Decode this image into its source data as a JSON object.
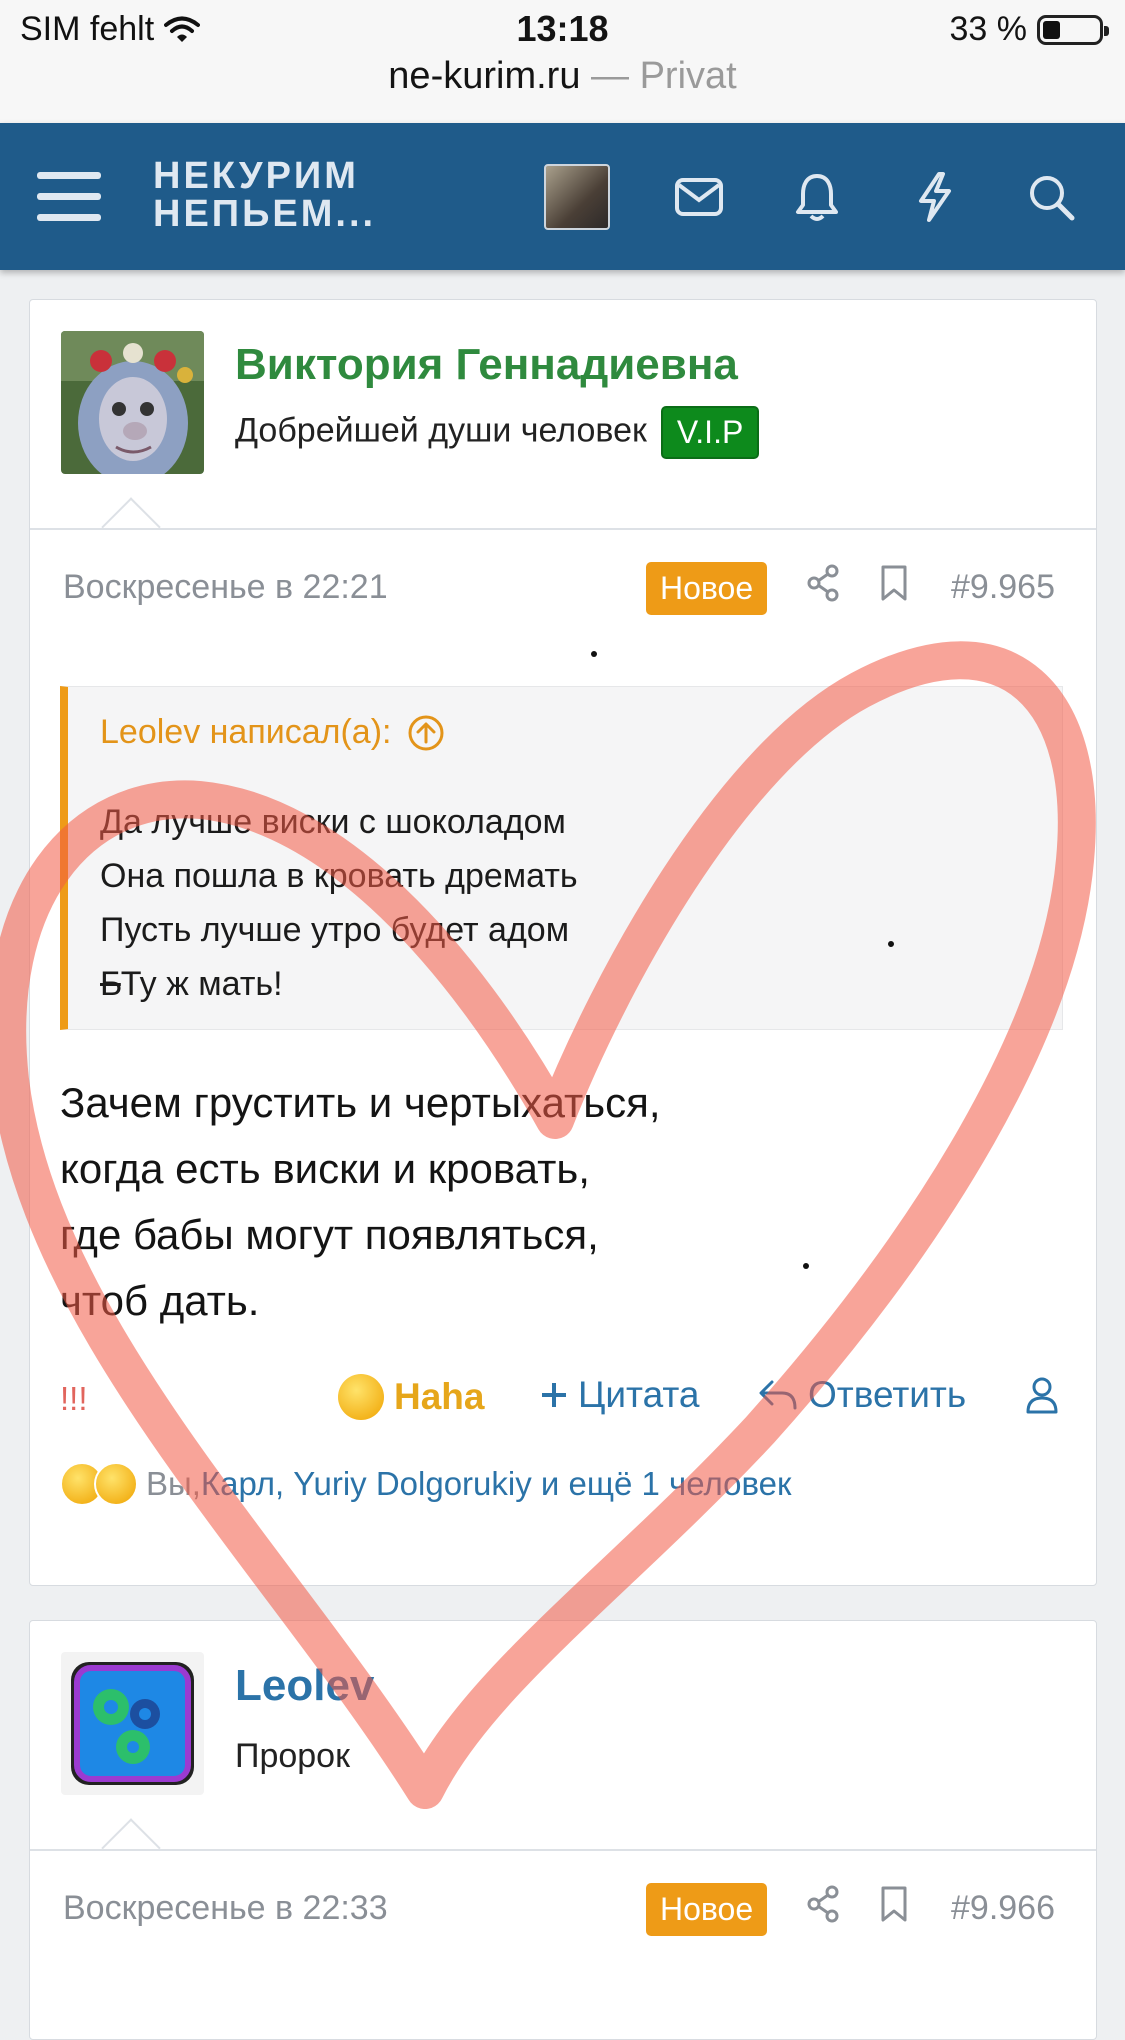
{
  "status_bar": {
    "carrier": "SIM fehlt",
    "time": "13:18",
    "battery": "33 %",
    "battery_level": 0.33,
    "url_domain": "ne-kurim.ru",
    "url_suffix": " — Privat"
  },
  "header": {
    "logo_line1": "НЕКУРИМ",
    "logo_line2": "НЕПЬЕМ...",
    "bg_color": "#1f5b8a"
  },
  "post1": {
    "author": "Виктория Геннадиевна",
    "author_color": "#2f8a3e",
    "user_title": "Добрейшей души человек",
    "badge": "V.I.P",
    "date": "Воскресенье в 22:21",
    "new_label": "Новое",
    "post_number": "#9.965",
    "quote": {
      "author_line": "Leolev написал(а):",
      "lines": [
        "Да лучше виски с шоколадом",
        "Она пошла в кровать дремать",
        "Пусть лучше утро будет адом"
      ],
      "last_struck": "Б",
      "last_rest": "Ту ж мать!"
    },
    "body_lines": [
      "Зачем грустить и чертыхаться,",
      "когда есть виски и кровать,",
      "где бабы могут появляться,",
      "чтоб дать."
    ],
    "report": "!!!",
    "reaction_label": "Haha",
    "quote_action": "Цитата",
    "reply_action": "Ответить",
    "reactions_prefix": "Вы, ",
    "reactions_users": "Карл, Yuriy Dolgorukiy и ещё 1 человек"
  },
  "post2": {
    "author": "Leolev",
    "author_color": "#2b73a8",
    "user_title": "Пророк",
    "date": "Воскресенье в 22:33",
    "new_label": "Новое",
    "post_number": "#9.966"
  },
  "icons": [
    "wifi-icon",
    "menu-icon",
    "envelope-icon",
    "bell-icon",
    "bolt-icon",
    "search-icon",
    "share-icon",
    "bookmark-icon",
    "arrow-up-circle-icon",
    "laugh-emoji-icon",
    "plus-icon",
    "reply-icon",
    "user-icon",
    "gears-avatar"
  ]
}
